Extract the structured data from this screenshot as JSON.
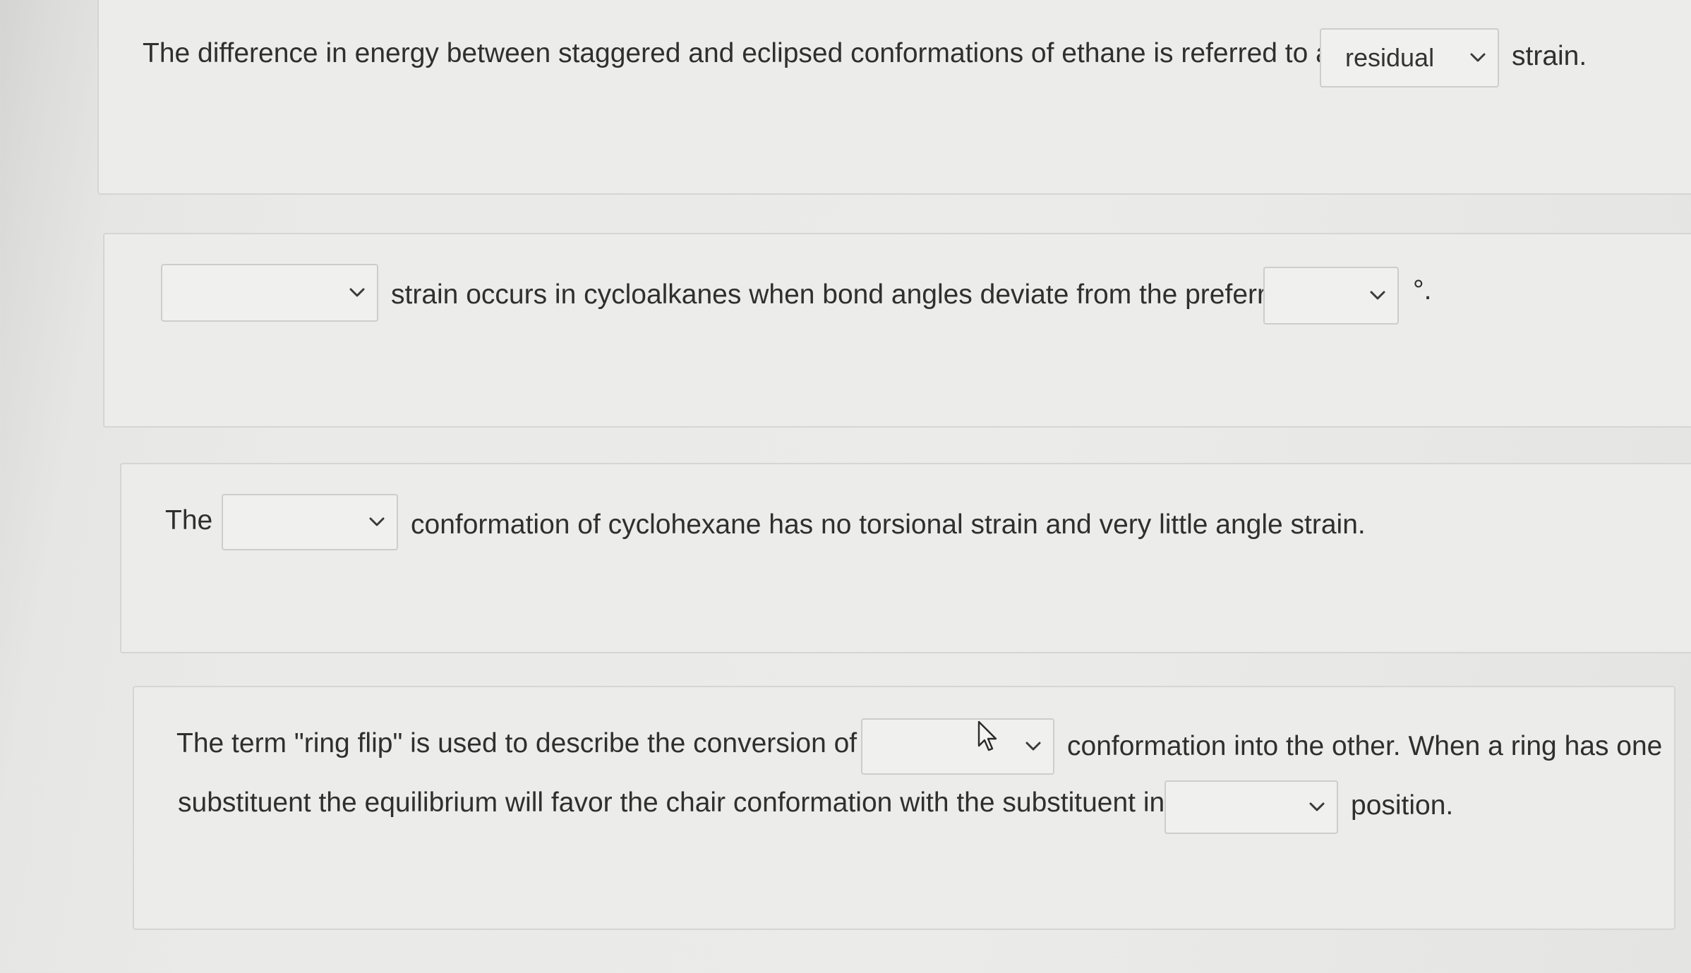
{
  "q1": {
    "text_before": "The difference in energy between staggered and eclipsed conformations of ethane is referred to as",
    "select_value": "residual",
    "text_after": "strain."
  },
  "q2": {
    "select1_value": "",
    "text_middle": "strain occurs in cycloalkanes when bond angles deviate from the preferred",
    "select2_value": "",
    "text_after": "°."
  },
  "q3": {
    "text_before": "The",
    "select_value": "",
    "text_after": "conformation of cyclohexane has no torsional strain and very little angle strain."
  },
  "q4": {
    "text_before": "The term \"ring flip\" is used to describe the conversion of one",
    "select1_value": "",
    "text_after_select1": "conformation into the other. When a ring has one",
    "line2_text": "substituent the equilibrium will favor the chair conformation with the substituent in the",
    "select2_value": "",
    "text_after_select2": "position."
  },
  "icons": {
    "dropdown": "chevron-down-icon",
    "cursor": "mouse-pointer-icon"
  }
}
